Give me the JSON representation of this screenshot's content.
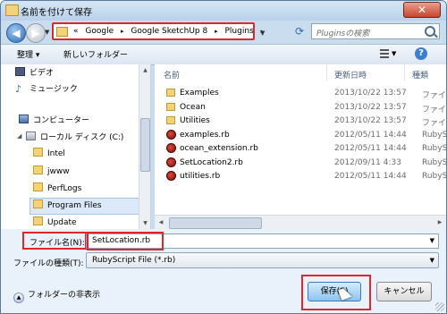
{
  "window": {
    "title": "名前を付けて保存",
    "close_label": "✕"
  },
  "address": {
    "overflow": "«",
    "crumbs": [
      "Google",
      "Google SketchUp 8",
      "Plugins"
    ],
    "separator": "▸",
    "search_placeholder": "Pluginsの検索"
  },
  "toolbar": {
    "organize": "整理 ▾",
    "new_folder": "新しいフォルダー"
  },
  "nav": {
    "items": [
      {
        "label": "ビデオ",
        "icon": "video-icon"
      },
      {
        "label": "ミュージック",
        "icon": "music-icon"
      },
      {
        "label": "コンピューター",
        "icon": "computer-icon"
      },
      {
        "label": "ローカル ディスク (C:)",
        "icon": "drive-icon"
      },
      {
        "label": "Intel",
        "icon": "folder-icon"
      },
      {
        "label": "jwww",
        "icon": "folder-icon"
      },
      {
        "label": "PerfLogs",
        "icon": "folder-icon"
      },
      {
        "label": "Program Files",
        "icon": "folder-icon",
        "selected": true
      },
      {
        "label": "Update",
        "icon": "folder-icon"
      }
    ]
  },
  "filelist": {
    "columns": {
      "name": "名前",
      "date": "更新日時",
      "type": "種類"
    },
    "rows": [
      {
        "name": "Examples",
        "date": "2013/10/22 13:57",
        "type": "ファイル",
        "kind": "folder"
      },
      {
        "name": "Ocean",
        "date": "2013/10/22 13:57",
        "type": "ファイル",
        "kind": "folder"
      },
      {
        "name": "Utilities",
        "date": "2013/10/22 13:57",
        "type": "ファイル",
        "kind": "folder"
      },
      {
        "name": "examples.rb",
        "date": "2012/05/11 14:44",
        "type": "RubySc",
        "kind": "ruby"
      },
      {
        "name": "ocean_extension.rb",
        "date": "2012/05/11 14:44",
        "type": "RubySc",
        "kind": "ruby"
      },
      {
        "name": "SetLocation2.rb",
        "date": "2012/09/11 4:33",
        "type": "RubySc",
        "kind": "ruby"
      },
      {
        "name": "utilities.rb",
        "date": "2012/05/11 14:44",
        "type": "RubySc",
        "kind": "ruby"
      }
    ]
  },
  "form": {
    "filename_label": "ファイル名(N):",
    "filename_value": "SetLocation.rb",
    "filetype_label": "ファイルの種類(T):",
    "filetype_value": "RubyScript File (*.rb)",
    "hide_folders": "フォルダーの非表示",
    "save_label": "保存(S)",
    "cancel_label": "キャンセル"
  },
  "colors": {
    "highlight": "#e0262b",
    "accent": "#3b7fd1"
  }
}
